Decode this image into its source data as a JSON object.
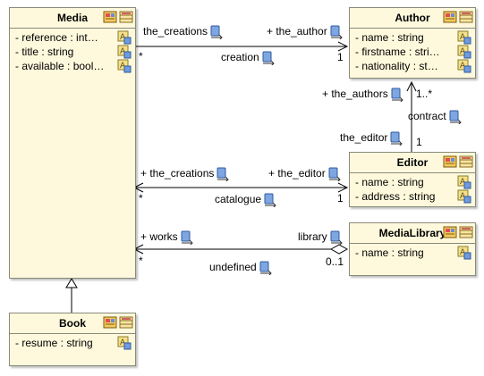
{
  "classes": {
    "media": {
      "name": "Media",
      "attrs": [
        "- reference : int…",
        "- title : string",
        "- available : bool…"
      ]
    },
    "author": {
      "name": "Author",
      "attrs": [
        "- name : string",
        "- firstname : stri…",
        "- nationality : st…"
      ]
    },
    "editor": {
      "name": "Editor",
      "attrs": [
        "- name : string",
        "- address : string"
      ]
    },
    "medialibrary": {
      "name": "MediaLibrary",
      "attrs": [
        "- name : string"
      ]
    },
    "book": {
      "name": "Book",
      "attrs": [
        "- resume : string"
      ]
    }
  },
  "associations": {
    "creation": {
      "src_role": "the_creations",
      "src_mult": "*",
      "name": "creation",
      "dst_role": "+ the_author",
      "dst_mult": "1"
    },
    "contract": {
      "src_role": "+ the_authors",
      "src_mult": "1..*",
      "name": "contract",
      "dst_role": "the_editor",
      "dst_mult": "1"
    },
    "catalogue": {
      "src_role": "+ the_creations",
      "src_mult": "*",
      "name": "catalogue",
      "dst_role": "+ the_editor",
      "dst_mult": "1"
    },
    "undefined": {
      "src_role": "+ works",
      "src_mult": "*",
      "name": "undefined",
      "dst_role": "library",
      "dst_mult": "0..1"
    }
  },
  "icons": {
    "class_header": "class-icon",
    "attribute": "attribute-icon",
    "label": "association-role-icon"
  }
}
